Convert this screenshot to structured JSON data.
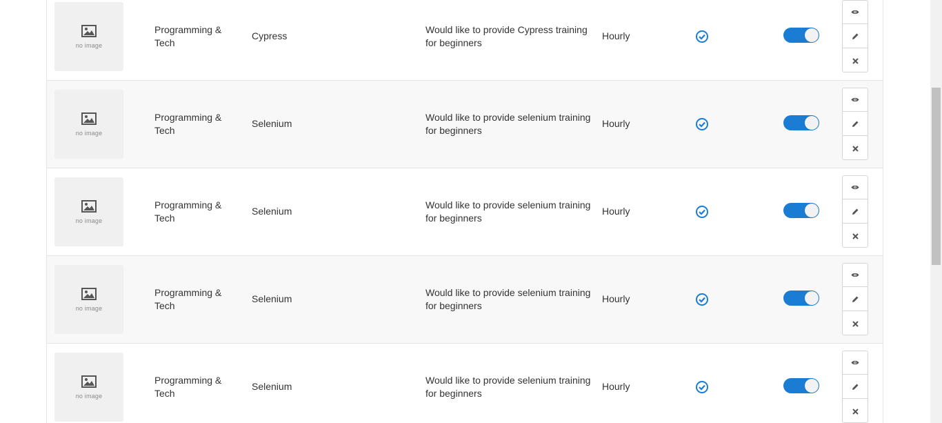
{
  "colors": {
    "accent": "#1a7cd3",
    "row_alt": "#f8f8f9",
    "border": "#e4e4e4"
  },
  "thumbnail": {
    "placeholder_text": "no image",
    "icon": "image-placeholder-icon"
  },
  "rows": [
    {
      "category": "Programming & Tech",
      "skill": "Cypress",
      "description": "Would like to provide Cypress training for beginners",
      "rate_type": "Hourly",
      "verified": true,
      "active": true
    },
    {
      "category": "Programming & Tech",
      "skill": "Selenium",
      "description": "Would like to provide selenium training for beginners",
      "rate_type": "Hourly",
      "verified": true,
      "active": true
    },
    {
      "category": "Programming & Tech",
      "skill": "Selenium",
      "description": "Would like to provide selenium training for beginners",
      "rate_type": "Hourly",
      "verified": true,
      "active": true
    },
    {
      "category": "Programming & Tech",
      "skill": "Selenium",
      "description": "Would like to provide selenium training for beginners",
      "rate_type": "Hourly",
      "verified": true,
      "active": true
    },
    {
      "category": "Programming & Tech",
      "skill": "Selenium",
      "description": "Would like to provide selenium training for beginners",
      "rate_type": "Hourly",
      "verified": true,
      "active": true
    }
  ],
  "actions": [
    "eye-icon",
    "pencil-icon",
    "close-icon"
  ]
}
